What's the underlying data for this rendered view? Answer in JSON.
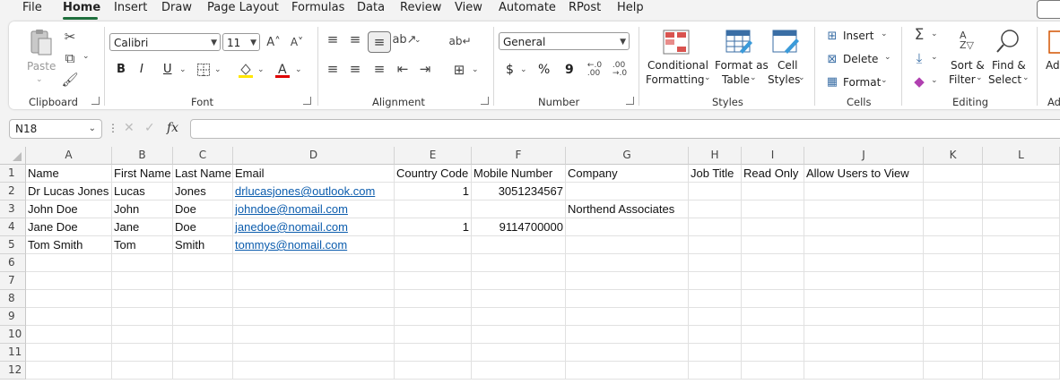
{
  "menu": {
    "tabs": [
      "File",
      "Home",
      "Insert",
      "Draw",
      "Page Layout",
      "Formulas",
      "Data",
      "Review",
      "View",
      "Automate",
      "RPost",
      "Help"
    ]
  },
  "ribbon": {
    "clipboard": {
      "label": "Clipboard",
      "paste": "Paste"
    },
    "font": {
      "label": "Font",
      "font_name": "Calibri",
      "font_size": "11",
      "bold": "B",
      "italic": "I",
      "underline": "U"
    },
    "alignment": {
      "label": "Alignment"
    },
    "number": {
      "label": "Number",
      "format": "General",
      "currency": "$",
      "percent": "%",
      "comma": "9"
    },
    "styles": {
      "label": "Styles",
      "conditional_1": "Conditional",
      "conditional_2": "Formatting",
      "format_table_1": "Format as",
      "format_table_2": "Table",
      "cell_styles_1": "Cell",
      "cell_styles_2": "Styles"
    },
    "cells": {
      "label": "Cells",
      "insert": "Insert",
      "delete": "Delete",
      "format": "Format"
    },
    "editing": {
      "label": "Editing",
      "sort_1": "Sort &",
      "sort_2": "Filter",
      "find_1": "Find &",
      "find_2": "Select"
    },
    "addins": {
      "label": "Add",
      "btn": "Ad"
    }
  },
  "formula_bar": {
    "name_box": "N18",
    "fx": "fx",
    "value": ""
  },
  "columns": [
    "A",
    "B",
    "C",
    "D",
    "E",
    "F",
    "G",
    "H",
    "I",
    "J",
    "K",
    "L"
  ],
  "rows": [
    "1",
    "2",
    "3",
    "4",
    "5",
    "6",
    "7",
    "8",
    "9",
    "10",
    "11",
    "12"
  ],
  "sheet": {
    "header": [
      "Name",
      "First Name",
      "Last Name",
      "Email",
      "Country Code",
      "Mobile Number",
      "Company",
      "Job Title",
      "Read Only",
      "Allow Users to View"
    ],
    "data": [
      {
        "name": "Dr Lucas Jones",
        "first": "Lucas",
        "last": "Jones",
        "email": "drlucasjones@outlook.com",
        "cc": "1",
        "mobile": "3051234567",
        "company": ""
      },
      {
        "name": "John Doe",
        "first": "John",
        "last": "Doe",
        "email": "johndoe@nomail.com",
        "cc": "",
        "mobile": "",
        "company": "Northend Associates"
      },
      {
        "name": "Jane Doe",
        "first": "Jane",
        "last": "Doe",
        "email": "janedoe@nomail.com",
        "cc": "1",
        "mobile": "9114700000",
        "company": ""
      },
      {
        "name": "Tom Smith",
        "first": "Tom",
        "last": "Smith",
        "email": "tommys@nomail.com",
        "cc": "",
        "mobile": "",
        "company": ""
      }
    ]
  }
}
